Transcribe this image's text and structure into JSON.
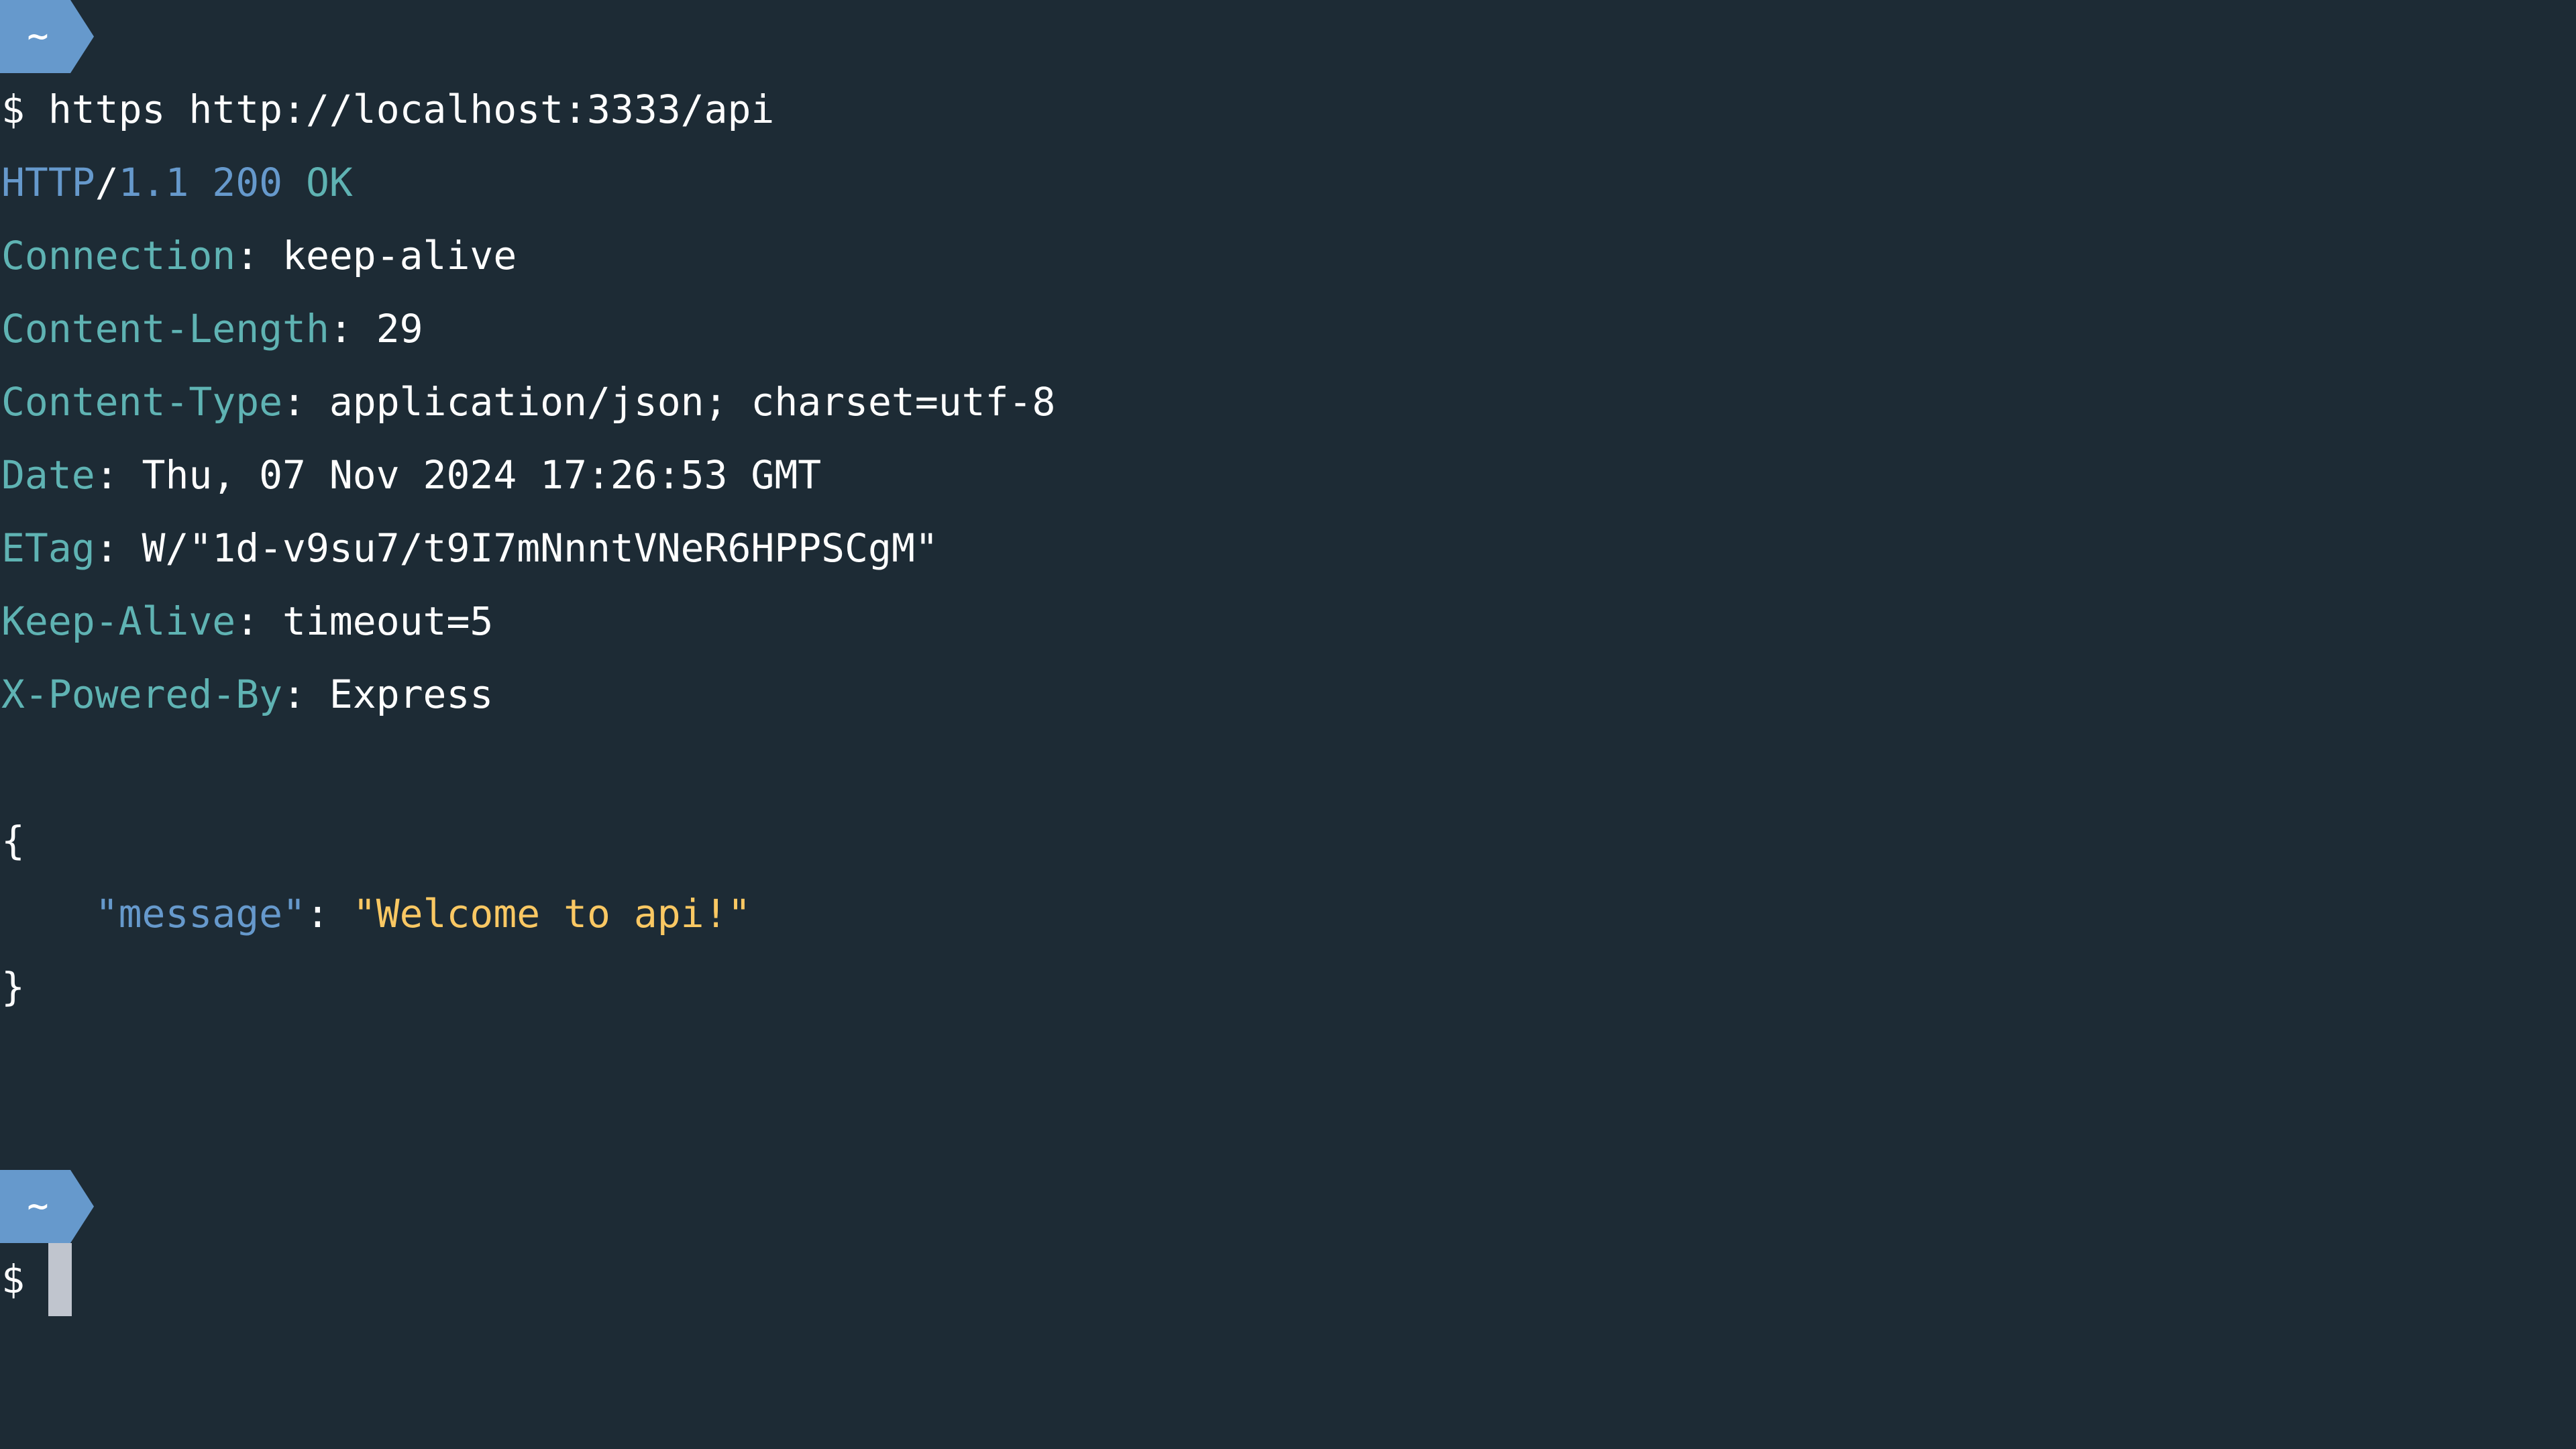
{
  "terminal": {
    "theme": {
      "background": "#1d2b35",
      "prompt_badge": "#6699cc",
      "key_color": "#5fb3b3",
      "protocol_color": "#6699cc",
      "string_color": "#fac863",
      "text_color": "#ffffff",
      "cursor_color": "#c0c5ce"
    },
    "prompt_badge_text": "~",
    "prompt_symbol": "$",
    "command": "https http://localhost:3333/api",
    "status_line": {
      "protocol": "HTTP",
      "slash": "/",
      "version": "1.1",
      "code": "200",
      "reason": "OK"
    },
    "headers": [
      {
        "name": "Connection",
        "value": "keep-alive"
      },
      {
        "name": "Content-Length",
        "value": "29"
      },
      {
        "name": "Content-Type",
        "value": "application/json; charset=utf-8"
      },
      {
        "name": "Date",
        "value": "Thu, 07 Nov 2024 17:26:53 GMT"
      },
      {
        "name": "ETag",
        "value": "W/\"1d-v9su7/t9I7mNnntVNeR6HPPSCgM\""
      },
      {
        "name": "Keep-Alive",
        "value": "timeout=5"
      },
      {
        "name": "X-Powered-By",
        "value": "Express"
      }
    ],
    "header_separator": ": ",
    "body": {
      "open_brace": "{",
      "close_brace": "}",
      "indent": "    ",
      "key": "\"message\"",
      "colon": ": ",
      "value": "\"Welcome to api!\""
    },
    "second_prompt_badge_text": "~",
    "second_prompt_symbol": "$"
  }
}
